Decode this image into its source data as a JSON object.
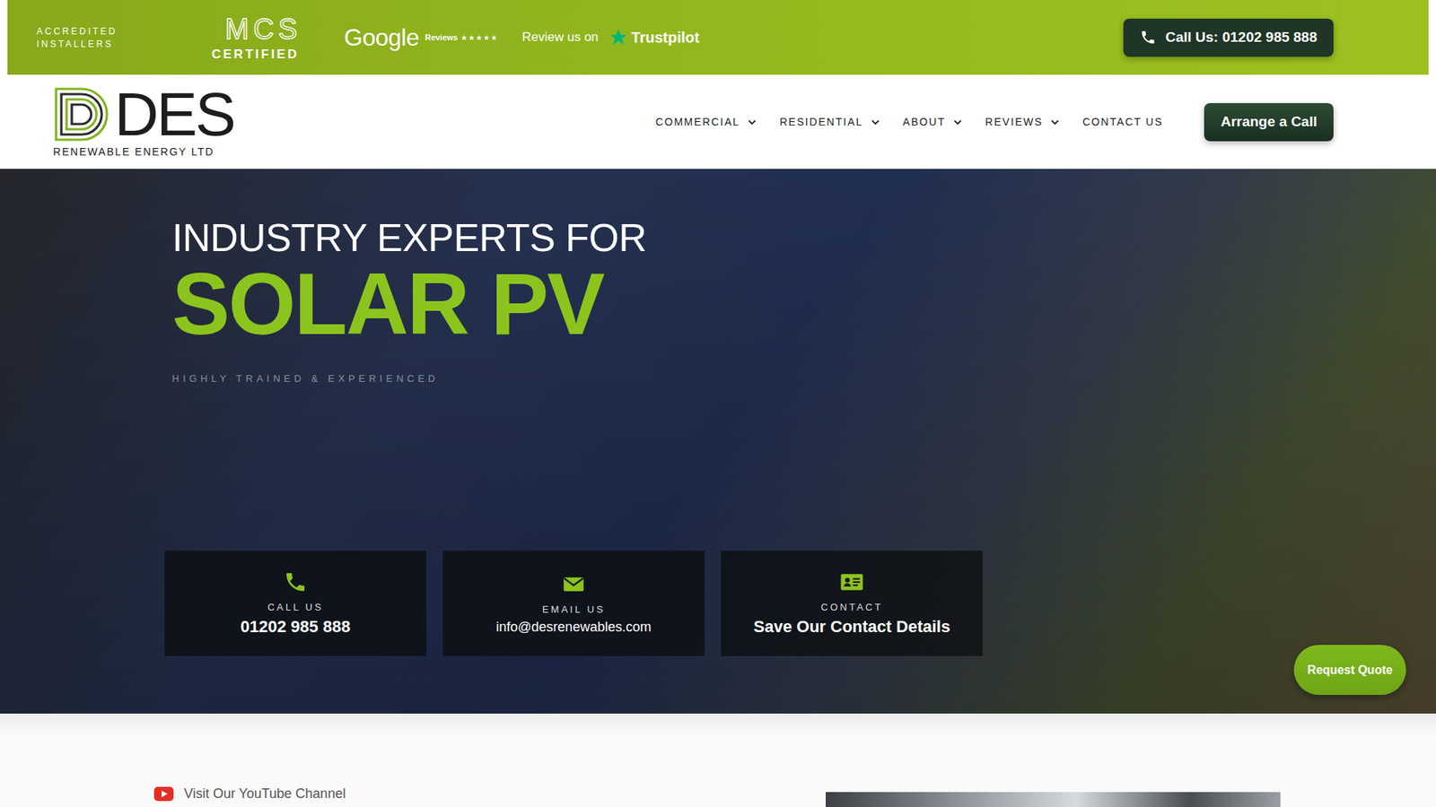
{
  "top_bar": {
    "accredited": [
      "ACCREDITED",
      "INSTALLERS"
    ],
    "mcs": {
      "mark": "MCS",
      "sub": "CERTIFIED"
    },
    "google": {
      "name": "Google",
      "label": "Reviews",
      "stars": 5
    },
    "trustpilot": {
      "prefix": "Review us on",
      "name": "Trustpilot"
    },
    "call_button": "Call Us: 01202 985 888"
  },
  "nav": {
    "logo": {
      "name": "DES",
      "sub": "RENEWABLE ENERGY LTD"
    },
    "items": [
      {
        "label": "COMMERCIAL",
        "has_dropdown": true
      },
      {
        "label": "RESIDENTIAL",
        "has_dropdown": true
      },
      {
        "label": "ABOUT",
        "has_dropdown": true
      },
      {
        "label": "REVIEWS",
        "has_dropdown": true
      },
      {
        "label": "CONTACT US",
        "has_dropdown": false
      }
    ],
    "cta": "Arrange a Call"
  },
  "hero": {
    "kicker": "INDUSTRY EXPERTS FOR",
    "title": "SOLAR PV",
    "tagline": "HIGHLY TRAINED & EXPERIENCED"
  },
  "contact_cards": [
    {
      "kind": "phone",
      "label": "CALL US",
      "value": "01202 985 888",
      "bold": true
    },
    {
      "kind": "email",
      "label": "EMAIL US",
      "value": "info@desrenewables.com",
      "bold": false
    },
    {
      "kind": "vcard",
      "label": "CONTACT",
      "value": "Save Our Contact Details",
      "bold": true
    }
  ],
  "floating_button": "Request Quote",
  "youtube_link": "Visit Our YouTube Channel"
}
